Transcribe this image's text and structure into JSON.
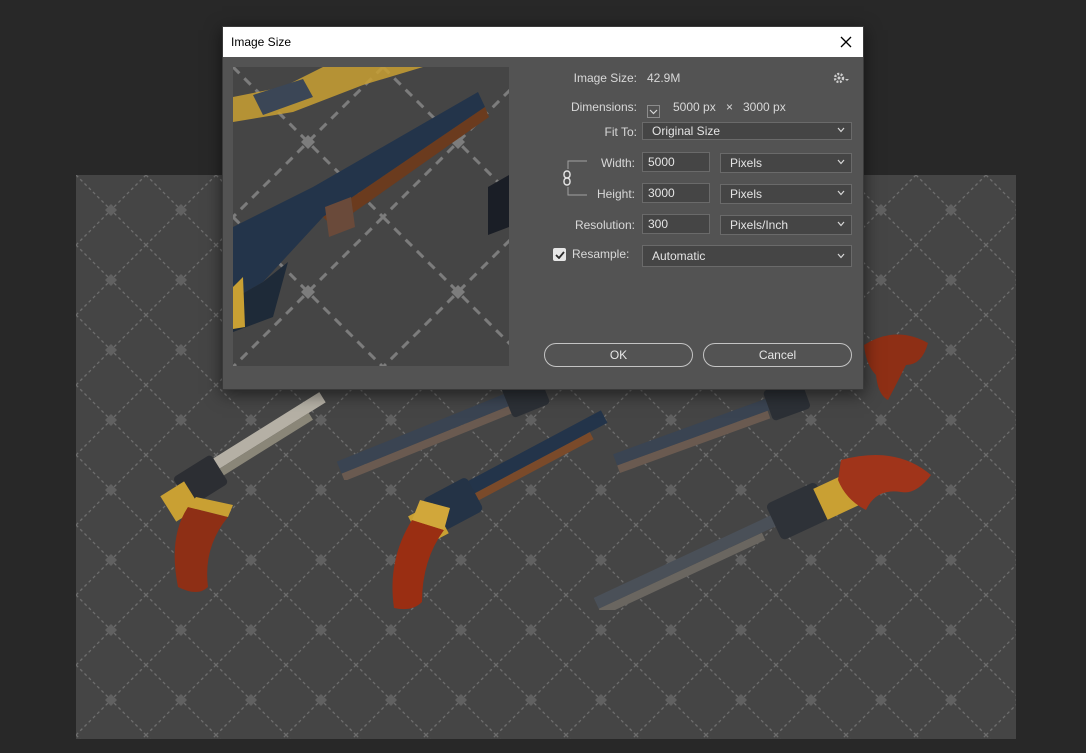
{
  "dialog": {
    "title": "Image Size",
    "image_size_label": "Image Size:",
    "image_size_value": "42.9M",
    "dimensions_label": "Dimensions:",
    "dimensions_width": "5000 px",
    "dimensions_sep": "×",
    "dimensions_height": "3000 px",
    "fit_to_label": "Fit To:",
    "fit_to_value": "Original Size",
    "width_label": "Width:",
    "width_value": "5000",
    "width_unit": "Pixels",
    "height_label": "Height:",
    "height_value": "3000",
    "height_unit": "Pixels",
    "resolution_label": "Resolution:",
    "resolution_value": "300",
    "resolution_unit": "Pixels/Inch",
    "resample_label": "Resample:",
    "resample_checked": true,
    "resample_value": "Automatic",
    "ok_label": "OK",
    "cancel_label": "Cancel"
  },
  "icons": [
    "close-icon",
    "gear-icon",
    "chevron-down-icon",
    "link-icon",
    "checkbox-icon"
  ],
  "colors": {
    "app_background": "#282828",
    "canvas_background": "#454545",
    "dialog_background": "#535353",
    "titlebar_background": "#ffffff",
    "lattice": "#6d6d6d",
    "wood": "#8e2f15",
    "brass": "#c9a033",
    "steel": "#2a3a4a"
  }
}
